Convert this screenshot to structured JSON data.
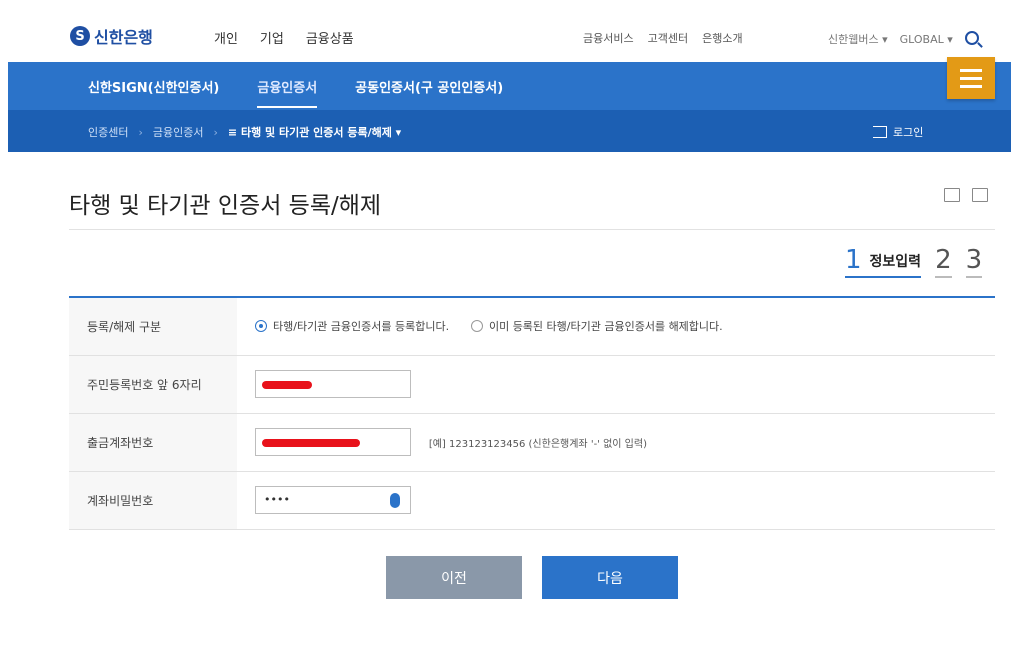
{
  "header": {
    "brand": "신한은행",
    "main_nav": [
      "개인",
      "기업",
      "금융상품"
    ],
    "util_nav": [
      "금융서비스",
      "고객센터",
      "은행소개"
    ],
    "family_site": "신한웹버스 ▾",
    "global": "GLOBAL ▾"
  },
  "subnav": {
    "tabs": [
      "신한SIGN(신한인증서)",
      "금융인증서",
      "공동인증서(구 공인인증서)"
    ],
    "active_index": 1
  },
  "breadcrumb": {
    "items": [
      "인증센터",
      "금융인증서"
    ],
    "current": "≡ 타행 및 타기관 인증서 등록/해제 ▾",
    "login": "로그인"
  },
  "page": {
    "title": "타행 및 타기관 인증서 등록/해제"
  },
  "steps": {
    "active_num": "1",
    "active_label": "정보입력",
    "others": [
      "2",
      "3"
    ]
  },
  "form": {
    "rows": [
      {
        "label": "등록/해제 구분"
      },
      {
        "label": "주민등록번호 앞 6자리"
      },
      {
        "label": "출금계좌번호"
      },
      {
        "label": "계좌비밀번호"
      }
    ],
    "radio_register": "타행/타기관 금융인증서를 등록합니다.",
    "radio_release": "이미 등록된 타행/타기관 금융인증서를 해제합니다.",
    "radio_selected": "register",
    "account_hint": "[예] 123123123456 (신한은행계좌 '-' 없이 입력)",
    "password_mask": "••••"
  },
  "buttons": {
    "prev": "이전",
    "next": "다음"
  },
  "colors": {
    "primary": "#2b73c9",
    "dark_blue": "#1c5fb3",
    "menu_orange": "#e39a16",
    "redaction": "#e8121b"
  }
}
